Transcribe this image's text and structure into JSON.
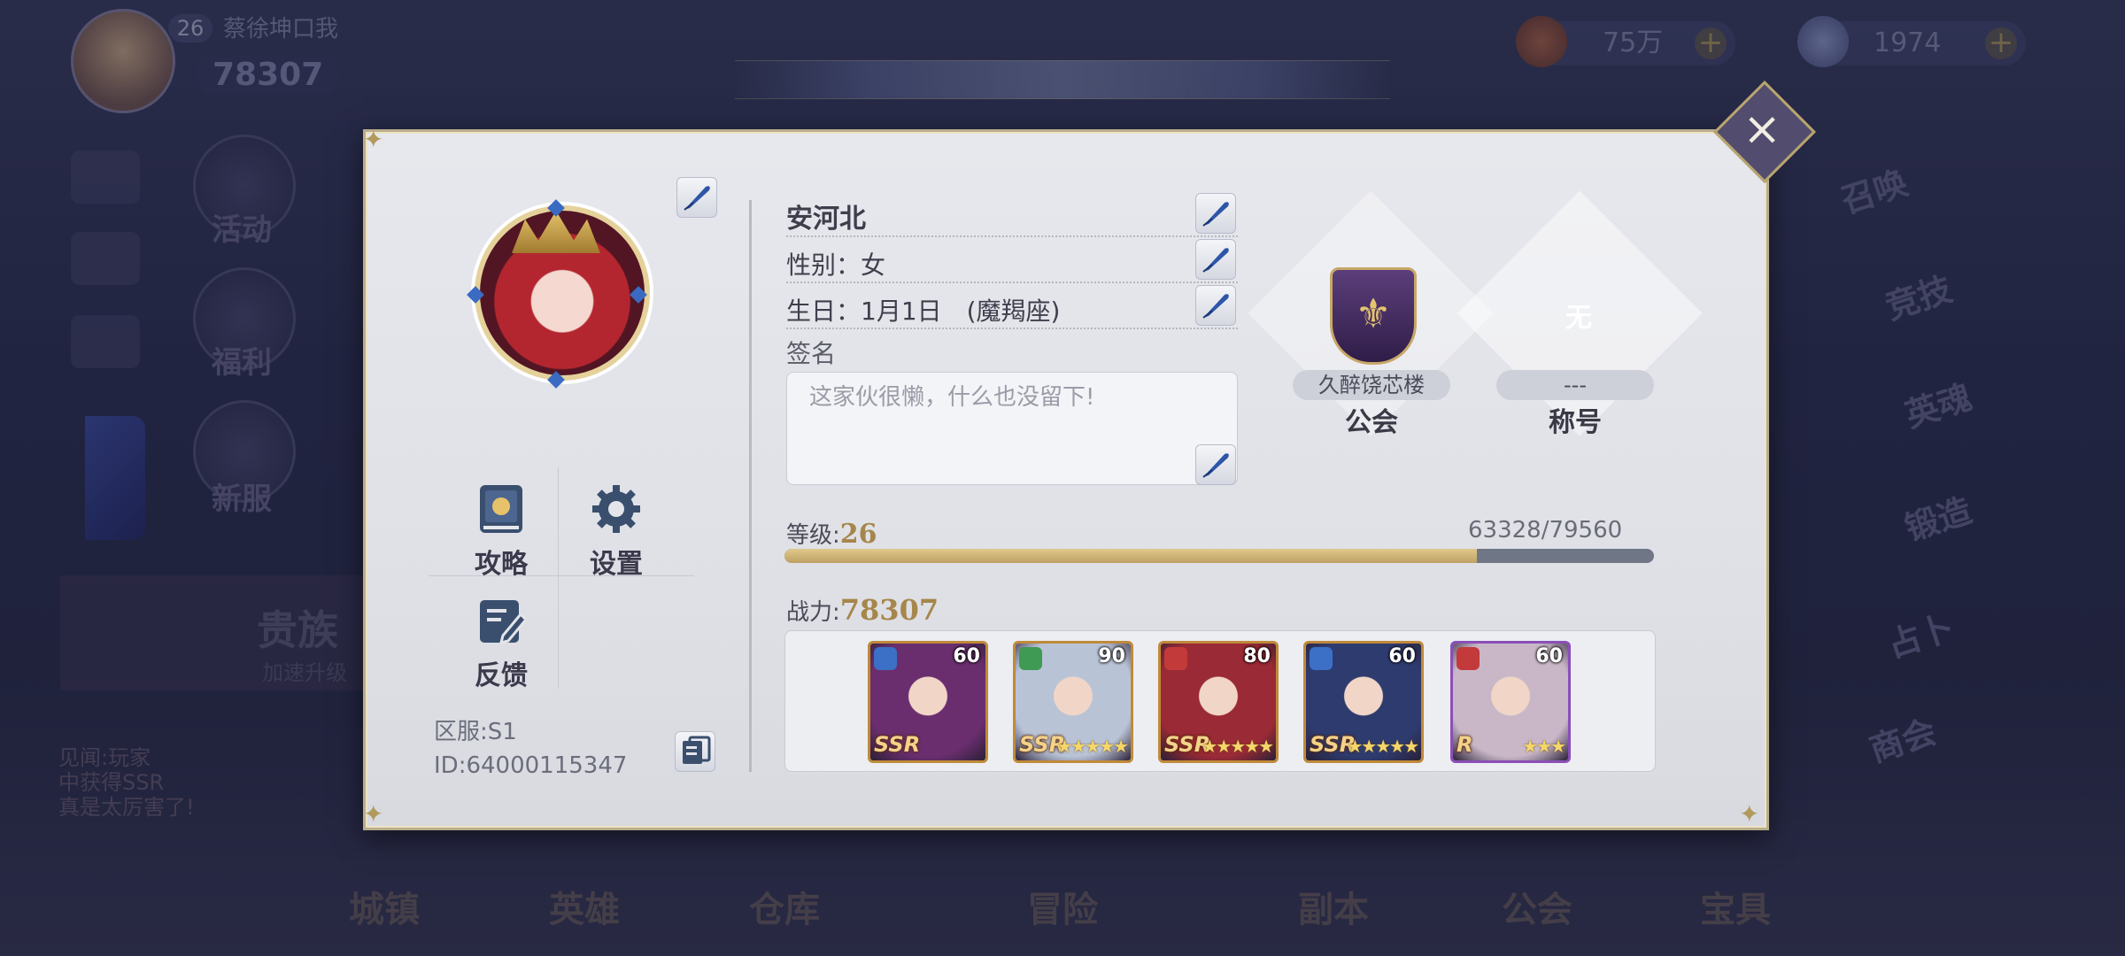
{
  "hud": {
    "player_level": "26",
    "player_name": "蔡徐坤口我",
    "power": "78307",
    "gold": "75万",
    "diamonds": "1974"
  },
  "left_menu": [
    "活动",
    "福利",
    "新服"
  ],
  "right_menu": [
    "召唤",
    "竞技",
    "英魂",
    "锻造",
    "占卜",
    "商会"
  ],
  "banner": {
    "title": "贵族",
    "subtitle": "加速升级"
  },
  "chat": {
    "line1": "见闻:玩家",
    "line2": "中获得SSR",
    "line3": "真是太厉害了!"
  },
  "bottom_nav": [
    "城镇",
    "英雄",
    "仓库",
    "冒险",
    "副本",
    "公会",
    "宝具"
  ],
  "profile": {
    "name": "安河北",
    "gender": "性别：女",
    "birthday": "生日：1月1日　(魔羯座)",
    "signature_label": "签名",
    "signature_placeholder": "这家伙很懒，什么也没留下!",
    "guild_name": "久醉饶芯楼",
    "guild_caption": "公会",
    "title_value": "---",
    "title_caption": "称号",
    "title_none": "无",
    "level_label": "等级:",
    "level": "26",
    "exp": "63328/79560",
    "exp_current": 63328,
    "exp_max": 79560,
    "power_label": "战力:",
    "power": "78307",
    "server": "区服:S1",
    "id": "ID:64000115347"
  },
  "menu": {
    "guide": "攻略",
    "settings": "设置",
    "feedback": "反馈"
  },
  "team": [
    {
      "level": "60",
      "rarity": "SSR",
      "stars": "",
      "element": "#3c6fc6",
      "frame": "#c08a3a",
      "bg": "#6a2e6e"
    },
    {
      "level": "90",
      "rarity": "SSR",
      "stars": "★★★★★",
      "element": "#3f9a54",
      "frame": "#c08a3a",
      "bg": "#b9c3d6"
    },
    {
      "level": "80",
      "rarity": "SSR",
      "stars": "★★★★★",
      "element": "#c33a3a",
      "frame": "#c08a3a",
      "bg": "#9a2a35"
    },
    {
      "level": "60",
      "rarity": "SSR",
      "stars": "★★★★★",
      "element": "#3c6fc6",
      "frame": "#c08a3a",
      "bg": "#2e3b6e"
    },
    {
      "level": "60",
      "rarity": "R",
      "stars": "★★★",
      "element": "#c33a3a",
      "frame": "#8a4fb8",
      "bg": "#c9b7c8"
    }
  ]
}
